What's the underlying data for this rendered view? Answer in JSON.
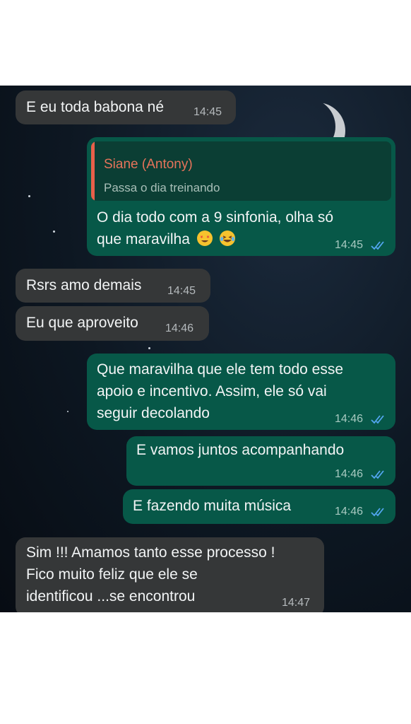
{
  "messages": [
    {
      "text": "E eu toda babona né",
      "time": "14:45"
    },
    {
      "quote_name": "Siane (Antony)",
      "quote_text": "Passa o dia treinando",
      "line1": "O dia todo com a 9 sinfonia, olha só",
      "line2": "que maravilha",
      "emojis": [
        "star-struck-emoji",
        "laughing-tears-emoji"
      ],
      "time": "14:45"
    },
    {
      "text": "Rsrs amo demais",
      "time": "14:45"
    },
    {
      "text": "Eu que aproveito",
      "time": "14:46"
    },
    {
      "line1": "Que maravilha que ele tem todo esse",
      "line2": "apoio e incentivo. Assim, ele só vai",
      "line3": "seguir decolando",
      "time": "14:46"
    },
    {
      "text": "E vamos juntos acompanhando",
      "time": "14:46"
    },
    {
      "text": "E fazendo muita música",
      "time": "14:46"
    },
    {
      "line1": "Sim !!! Amamos tanto esse processo !",
      "line2": "Fico muito feliz que ele se",
      "line3": "identificou ...se encontrou",
      "time": "14:47"
    }
  ],
  "colors": {
    "incoming_bubble": "#353738",
    "outgoing_bubble": "#075848",
    "read_ticks": "#53a6f0",
    "quote_accent": "#e8604a"
  }
}
